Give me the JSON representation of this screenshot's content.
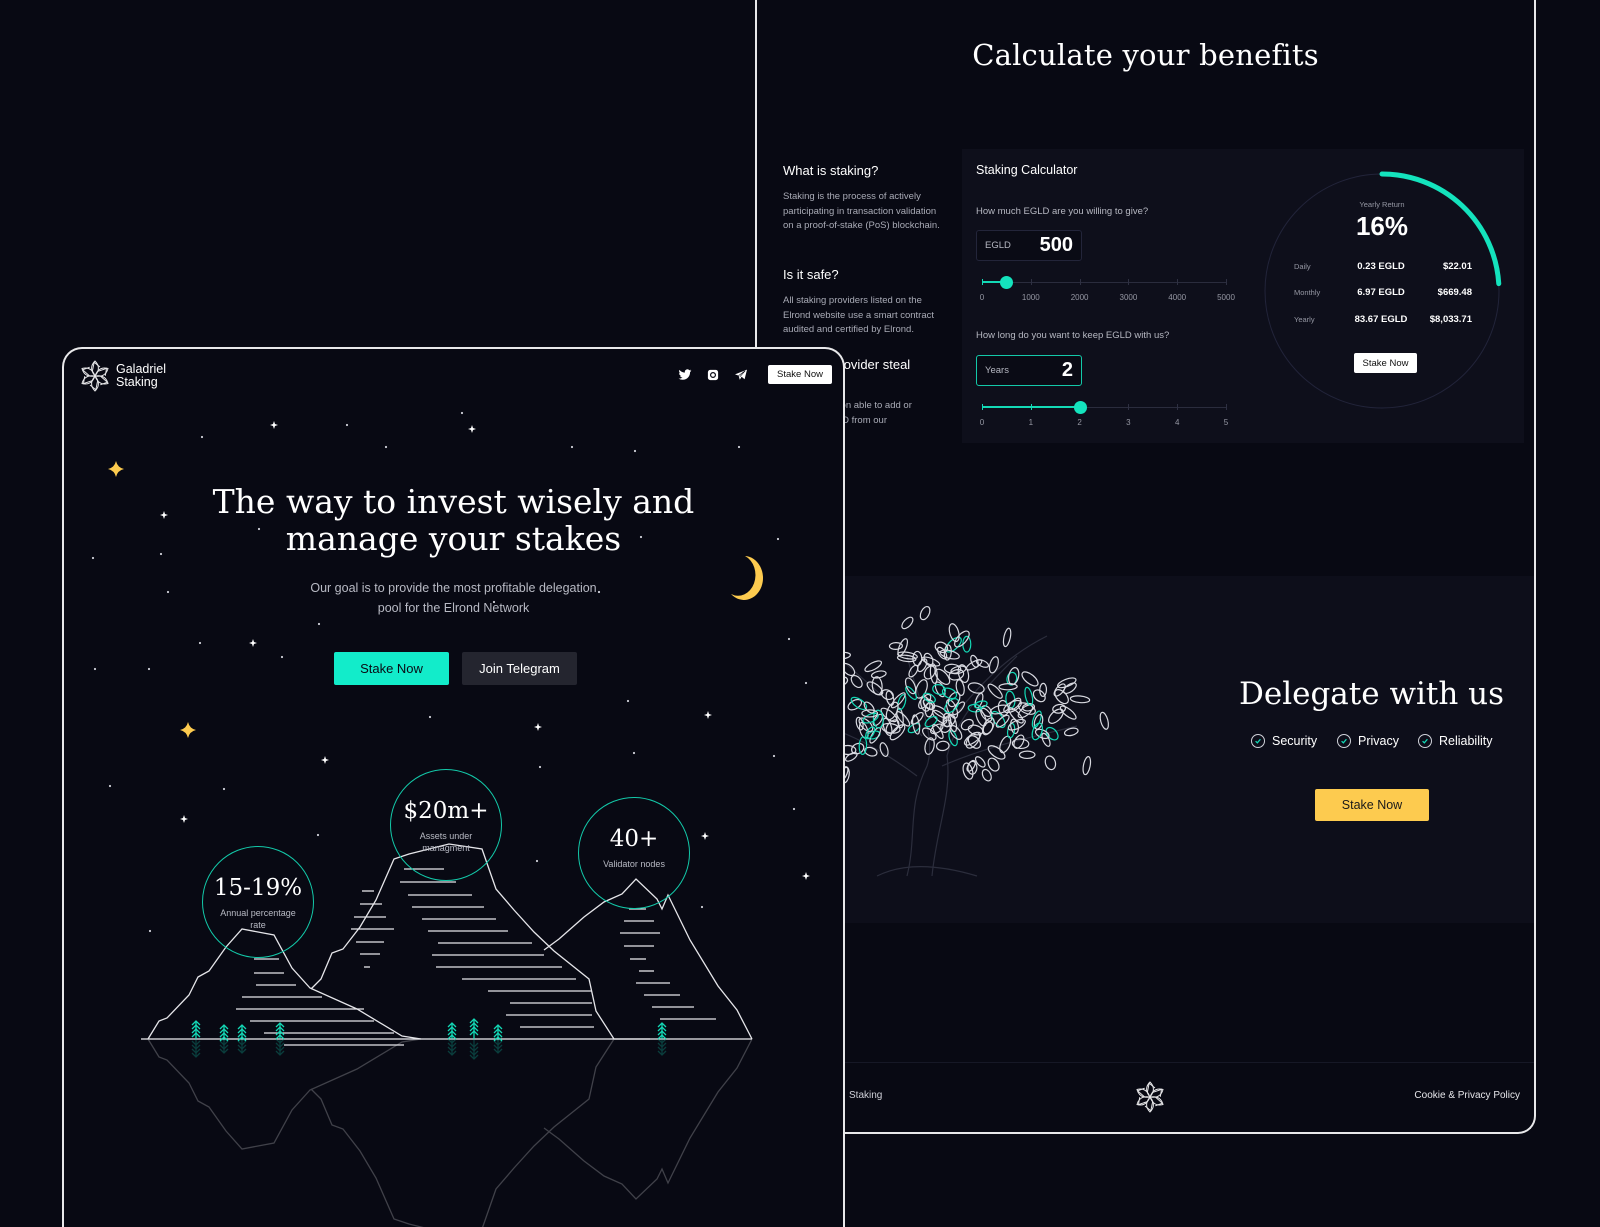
{
  "colors": {
    "background": "#080913",
    "accent_teal": "#12ecca",
    "accent_yellow": "#fdcb4f",
    "card": "#0e0f1b",
    "frame_border": "#e8e8ea"
  },
  "calculator_page": {
    "title": "Calculate your benefits",
    "faq": [
      {
        "question": "What is staking?",
        "answer": "Staking is the process of actively participating in transaction validation on a proof-of-stake (PoS) blockchain."
      },
      {
        "question": "Is it safe?",
        "answer": "All staking providers listed on the Elrond website use a smart contract audited and certified by Elrond."
      },
      {
        "question": "Can the provider steal EGLD?",
        "answer": "The only person able to add or withdraw EGLD from our"
      }
    ],
    "calculator": {
      "title": "Staking Calculator",
      "amount_question": "How much EGLD are you willing to give?",
      "amount_label": "EGLD",
      "amount_value": "500",
      "amount_slider": {
        "min": 0,
        "max": 5000,
        "value": 500,
        "ticks": [
          "0",
          "1000",
          "2000",
          "3000",
          "4000",
          "5000"
        ]
      },
      "duration_question": "How long do you want to keep EGLD with us?",
      "duration_label": "Years",
      "duration_value": "2",
      "duration_slider": {
        "min": 0,
        "max": 5,
        "value": 2,
        "ticks": [
          "0",
          "1",
          "2",
          "3",
          "4",
          "5"
        ]
      },
      "yearly_return_label": "Yearly Return",
      "yearly_return_value": "16%",
      "yearly_return_fraction": 0.16,
      "rows": [
        {
          "period": "Daily",
          "egld": "0.23 EGLD",
          "usd": "$22.01"
        },
        {
          "period": "Monthly",
          "egld": "6.97 EGLD",
          "usd": "$669.48"
        },
        {
          "period": "Yearly",
          "egld": "83.67 EGLD",
          "usd": "$8,033.71"
        }
      ],
      "stake_button": "Stake Now"
    },
    "delegate": {
      "title": "Delegate with us",
      "features": [
        "Security",
        "Privacy",
        "Reliability"
      ],
      "button": "Stake Now"
    },
    "footer": {
      "left_text": "Galadriel Staking",
      "left_visible": "Staking",
      "right_link": "Cookie & Privacy Policy"
    }
  },
  "landing_page": {
    "brand": {
      "line1": "Galadriel",
      "line2": "Staking"
    },
    "nav": {
      "social": [
        "twitter-icon",
        "instagram-icon",
        "telegram-icon"
      ],
      "stake_button": "Stake Now"
    },
    "hero": {
      "title_line1": "The way to invest wisely and",
      "title_line2": "manage your stakes",
      "subtitle_line1": "Our goal is to provide the most profitable delegation",
      "subtitle_line2": "pool for the Elrond Network",
      "primary_button": "Stake Now",
      "secondary_button": "Join Telegram"
    },
    "stats": [
      {
        "value": "15-19%",
        "label": "Annual percentage rate"
      },
      {
        "value": "$20m+",
        "label": "Assets under managment"
      },
      {
        "value": "40+",
        "label": "Validator nodes"
      }
    ]
  }
}
